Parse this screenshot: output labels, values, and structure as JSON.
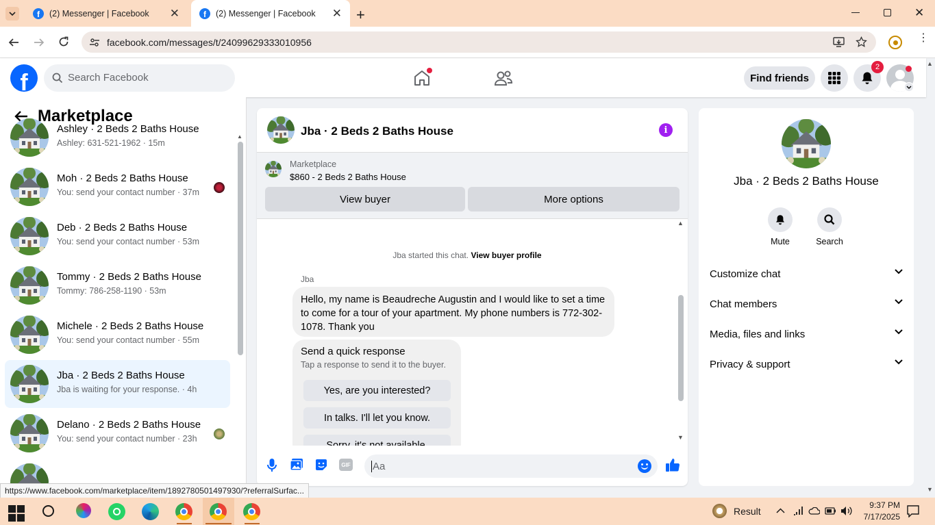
{
  "browser": {
    "tabs": [
      {
        "title": "(2) Messenger | Facebook"
      },
      {
        "title": "(2) Messenger | Facebook"
      }
    ],
    "url": "facebook.com/messages/t/24099629333010956",
    "status_url": "https://www.facebook.com/marketplace/item/1892780501497930/?referralSurfac..."
  },
  "fb_header": {
    "logo": "f",
    "search_placeholder": "Search Facebook",
    "find_friends": "Find friends",
    "notification_count": "2"
  },
  "left_panel": {
    "title": "Marketplace",
    "conversations": [
      {
        "name": "Ashley · 2 Beds 2 Baths House",
        "preview": "Ashley: 631-521-1962 · 15m"
      },
      {
        "name": "Moh · 2 Beds 2 Baths House",
        "preview": "You: send your contact number · 37m"
      },
      {
        "name": "Deb · 2 Beds 2 Baths House",
        "preview": "You: send your contact number · 53m"
      },
      {
        "name": "Tommy · 2 Beds 2 Baths House",
        "preview": "Tommy: 786-258-1190 · 53m"
      },
      {
        "name": "Michele · 2 Beds 2 Baths House",
        "preview": "You: send your contact number · 55m"
      },
      {
        "name": "Jba · 2 Beds 2 Baths House",
        "preview": "Jba is waiting for your response. · 4h"
      },
      {
        "name": "Delano · 2 Beds 2 Baths House",
        "preview": "You: send your contact number · 23h"
      }
    ]
  },
  "chat": {
    "title": "Jba · 2 Beds 2 Baths House",
    "marketplace_label": "Marketplace",
    "listing": "$860 - 2 Beds 2 Baths House",
    "view_buyer": "View buyer",
    "more_options": "More options",
    "started_text": "Jba started this chat.",
    "view_buyer_profile": "View buyer profile",
    "sender": "Jba",
    "message": "Hello, my name is Beaudreche Augustin and I would like to set a time to come for a tour of your apartment. My phone numbers is 772-302-1078. Thank you",
    "quick_title": "Send a quick response",
    "quick_sub": "Tap a response to send it to the buyer.",
    "quick_replies": [
      "Yes, are you interested?",
      "In talks. I'll let you know.",
      "Sorry, it's not available."
    ],
    "input_placeholder": "Aa",
    "gif_label": "GIF"
  },
  "right_panel": {
    "title": "Jba · 2 Beds 2 Baths House",
    "mute": "Mute",
    "search": "Search",
    "sections": [
      "Customize chat",
      "Chat members",
      "Media, files and links",
      "Privacy & support"
    ]
  },
  "taskbar": {
    "weather": "Result",
    "time": "9:37 PM",
    "date": "7/17/2025"
  },
  "colors": {
    "fb_blue": "#0866ff",
    "purple": "#a020f0",
    "chrome_bg": "#fbdcc4"
  }
}
